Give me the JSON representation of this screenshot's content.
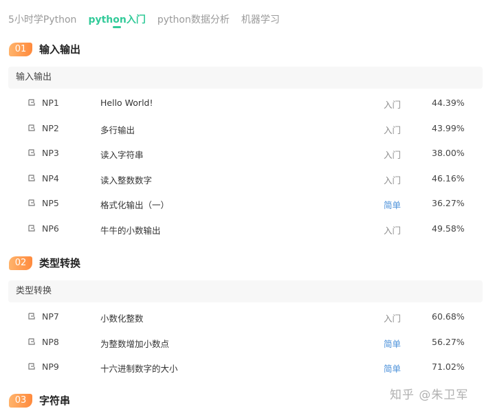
{
  "tabs": [
    {
      "label": "5小时学Python"
    },
    {
      "label": "python入门"
    },
    {
      "label": "python数据分析"
    },
    {
      "label": "机器学习"
    }
  ],
  "sections": [
    {
      "num": "01",
      "title": "输入输出",
      "subtitle": "输入输出",
      "rows": [
        {
          "code": "NP1",
          "name": "Hello World!",
          "difficulty": "入门",
          "rate": "44.39%"
        },
        {
          "code": "NP2",
          "name": "多行输出",
          "difficulty": "入门",
          "rate": "43.99%"
        },
        {
          "code": "NP3",
          "name": "读入字符串",
          "difficulty": "入门",
          "rate": "38.00%"
        },
        {
          "code": "NP4",
          "name": "读入整数数字",
          "difficulty": "入门",
          "rate": "46.16%"
        },
        {
          "code": "NP5",
          "name": "格式化输出（一）",
          "difficulty": "简单",
          "rate": "36.27%"
        },
        {
          "code": "NP6",
          "name": "牛牛的小数输出",
          "difficulty": "入门",
          "rate": "49.58%"
        }
      ]
    },
    {
      "num": "02",
      "title": "类型转换",
      "subtitle": "类型转换",
      "rows": [
        {
          "code": "NP7",
          "name": "小数化整数",
          "difficulty": "入门",
          "rate": "60.68%"
        },
        {
          "code": "NP8",
          "name": "为整数增加小数点",
          "difficulty": "简单",
          "rate": "56.27%"
        },
        {
          "code": "NP9",
          "name": "十六进制数字的大小",
          "difficulty": "简单",
          "rate": "71.02%"
        }
      ]
    },
    {
      "num": "03",
      "title": "字符串"
    }
  ],
  "watermark": "知乎 @朱卫军",
  "colors": {
    "accent": "#32ca99",
    "badge_start": "#ffb36b",
    "badge_end": "#ff8a3d",
    "difficulty_easy": "#4a90d9",
    "difficulty_intro": "#8c8c8c"
  }
}
